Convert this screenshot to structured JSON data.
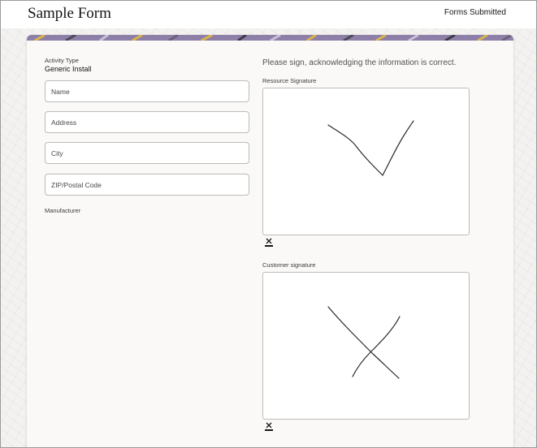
{
  "header": {
    "title": "Sample Form",
    "forms_link": "Forms Submitted"
  },
  "form": {
    "activity_type_label": "Activity Type",
    "activity_type_value": "Generic Install",
    "fields": [
      {
        "placeholder": "Name",
        "value": ""
      },
      {
        "placeholder": "Address",
        "value": ""
      },
      {
        "placeholder": "City",
        "value": ""
      },
      {
        "placeholder": "ZIP/Postal Code",
        "value": ""
      }
    ],
    "manufacturer_label": "Manufacturer"
  },
  "signatures": {
    "prompt": "Please sign, acknowledging the information is correct.",
    "resource_label": "Resource Signature",
    "customer_label": "Customer signature",
    "clear_icon": "eraser-clear-icon"
  },
  "colors": {
    "banner_purple": "#8e7fa8",
    "banner_gold": "#d9b64a",
    "page_bg": "#f3f2f0"
  }
}
